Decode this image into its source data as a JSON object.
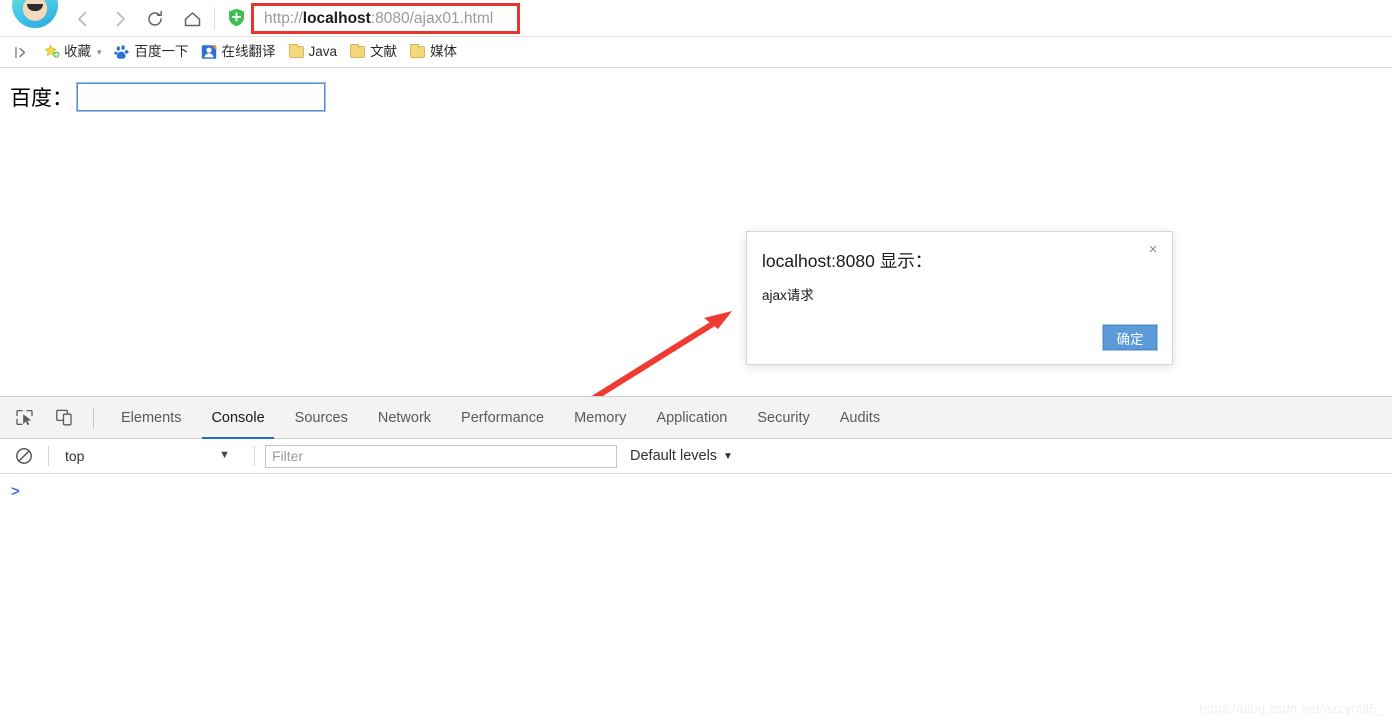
{
  "browser": {
    "nav": {
      "back_label": "Back",
      "forward_label": "Forward",
      "reload_label": "Reload",
      "home_label": "Home"
    },
    "omnibox": {
      "scheme": "http://",
      "host": "localhost",
      "rest": ":8080/ajax01.html",
      "full_url": "http://localhost:8080/ajax01.html",
      "highlight_color": "#e8342a"
    },
    "bookmarks": {
      "overflow_label": "|>",
      "items": [
        {
          "label": "收藏",
          "icon": "star-icon",
          "has_chevron": true
        },
        {
          "label": "百度一下",
          "icon": "baidu-paw-icon",
          "has_chevron": false
        },
        {
          "label": "在线翻译",
          "icon": "translate-icon",
          "has_chevron": false
        },
        {
          "label": "Java",
          "icon": "folder-icon",
          "has_chevron": false
        },
        {
          "label": "文献",
          "icon": "folder-icon",
          "has_chevron": false
        },
        {
          "label": "媒体",
          "icon": "folder-icon",
          "has_chevron": false
        }
      ]
    }
  },
  "page": {
    "form_label": "百度：",
    "input_value": "",
    "input_placeholder": ""
  },
  "dialog": {
    "title": "localhost:8080 显示：",
    "message": "ajax请求",
    "ok_label": "确定",
    "close_label": "×",
    "accent_color": "#5b9bd8"
  },
  "devtools": {
    "tabs": [
      {
        "label": "Elements",
        "active": false
      },
      {
        "label": "Console",
        "active": true
      },
      {
        "label": "Sources",
        "active": false
      },
      {
        "label": "Network",
        "active": false
      },
      {
        "label": "Performance",
        "active": false
      },
      {
        "label": "Memory",
        "active": false
      },
      {
        "label": "Application",
        "active": false
      },
      {
        "label": "Security",
        "active": false
      },
      {
        "label": "Audits",
        "active": false
      }
    ],
    "active_tab_underline_color": "#1a73c8",
    "console": {
      "clear_label": "Clear console",
      "context_value": "top",
      "filter_placeholder": "Filter",
      "filter_value": "",
      "levels_label": "Default levels",
      "prompt_symbol": ">"
    }
  },
  "watermark": {
    "text": "https://blog.csdn.net/nzzynl95_"
  }
}
